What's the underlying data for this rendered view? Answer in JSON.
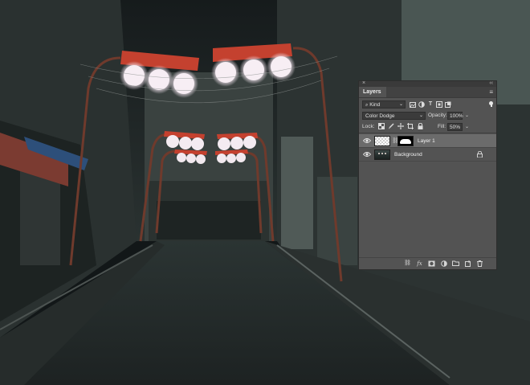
{
  "canvas": {
    "description_hidden": "",
    "colors": {
      "sky": "#1c2326",
      "road": "#2a302f",
      "lamp_red": "#c9402f",
      "lamp_glow": "#f6eef2"
    }
  },
  "layers_panel": {
    "close_icon": "close-icon",
    "collapse_icon": "double-chevron-icon",
    "tab_label": "Layers",
    "menu_icon": "panel-menu-icon",
    "filter": {
      "kind_label": "Kind",
      "search_icon": "search-icon",
      "icons": [
        "pixel-filter-icon",
        "adjustment-filter-icon",
        "type-filter-icon",
        "shape-filter-icon",
        "smart-object-filter-icon"
      ],
      "toggle_state": "on"
    },
    "blend_mode": "Color Dodge",
    "opacity_label": "Opacity:",
    "opacity_value": "100%",
    "lock_label": "Lock:",
    "lock_icons": [
      "lock-transparent-icon",
      "lock-paint-icon",
      "lock-move-icon",
      "lock-artboard-icon",
      "lock-all-icon"
    ],
    "fill_label": "Fill:",
    "fill_value": "50%",
    "layers": [
      {
        "name": "Layer 1",
        "visible": true,
        "selected": true,
        "has_mask": true,
        "locked": false
      },
      {
        "name": "Background",
        "visible": true,
        "selected": false,
        "has_mask": false,
        "locked": true
      }
    ],
    "bottom_icons": [
      "link-layers-icon",
      "fx-icon",
      "add-mask-icon",
      "adjustment-layer-icon",
      "new-group-icon",
      "new-layer-icon",
      "delete-layer-icon"
    ]
  }
}
